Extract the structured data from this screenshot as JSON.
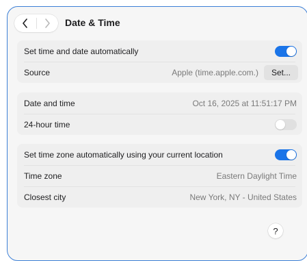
{
  "header": {
    "title": "Date & Time",
    "back_icon": "chevron-left-icon",
    "forward_icon": "chevron-right-icon"
  },
  "auto_section": {
    "auto_label": "Set time and date automatically",
    "auto_toggle_on": true,
    "source_label": "Source",
    "source_value": "Apple (time.apple.com.)",
    "set_button_label": "Set..."
  },
  "time_section": {
    "datetime_label": "Date and time",
    "datetime_value": "Oct 16, 2025 at 11:51:17 PM",
    "hour24_label": "24-hour time",
    "hour24_toggle_on": false
  },
  "timezone_section": {
    "auto_tz_label": "Set time zone automatically using your current location",
    "auto_tz_toggle_on": true,
    "timezone_label": "Time zone",
    "timezone_value": "Eastern Daylight Time",
    "city_label": "Closest city",
    "city_value": "New York, NY - United States"
  },
  "help_label": "?",
  "colors": {
    "accent": "#1a74e8",
    "window_border": "#3c7fd6",
    "card_bg": "#efefef"
  }
}
